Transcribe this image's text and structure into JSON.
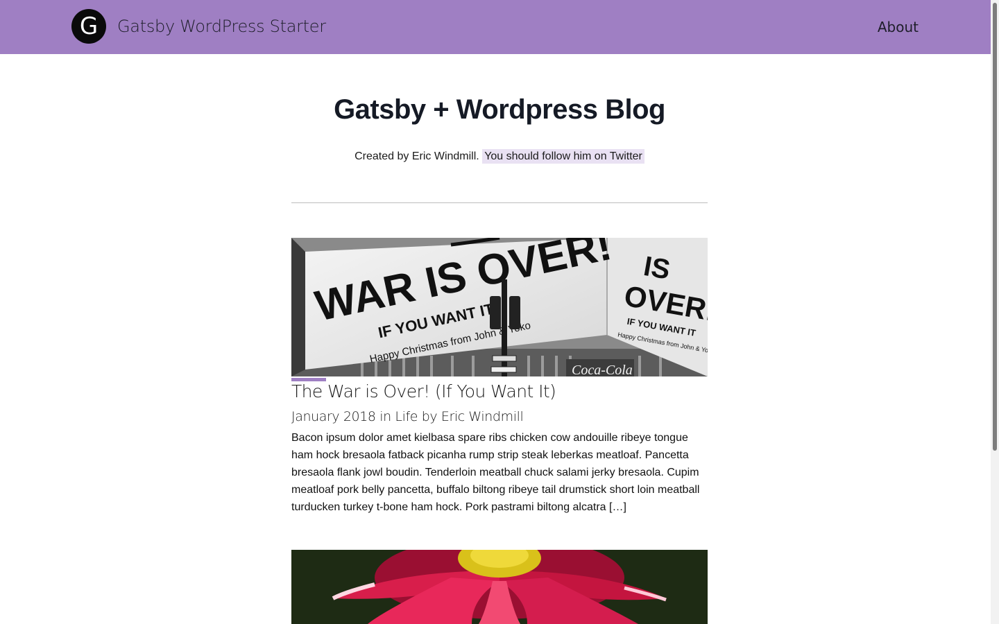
{
  "header": {
    "logo_letter": "G",
    "site_title": "Gatsby WordPress Starter",
    "nav": {
      "about_label": "About"
    },
    "brand_color": "#9f7fc3"
  },
  "hero": {
    "title": "Gatsby + Wordpress Blog",
    "created_by": "Created by Eric Windmill.",
    "twitter_link": "You should follow him on Twitter"
  },
  "posts": [
    {
      "title": "The War is Over! (If You Want It)",
      "meta": "January 2018 in Life by Eric Windmill",
      "excerpt": "Bacon ipsum dolor amet kielbasa spare ribs chicken cow andouille ribeye tongue ham hock bresaola fatback picanha rump strip steak leberkas meatloaf. Pancetta bresaola flank jowl boudin. Tenderloin meatball chuck salami jerky bresaola. Cupim meatloaf pork belly pancetta, buffalo biltong ribeye tail drumstick short loin meatball turducken turkey t-bone ham hock. Pork pastrami biltong alcatra […]",
      "image": {
        "sign_main": "WAR IS OVER!",
        "sign_sub": "IF YOU WANT IT",
        "sign_small": "Happy Christmas from John & Yoko",
        "sign_right_1": "IS",
        "sign_right_2": "OVER!",
        "sign_right_3": "IF YOU WANT IT",
        "sign_right_4": "Happy Christmas from John & Yoko",
        "ad_text": "Coca-Cola"
      }
    },
    {
      "image": {
        "icon": "flower-image"
      }
    }
  ]
}
